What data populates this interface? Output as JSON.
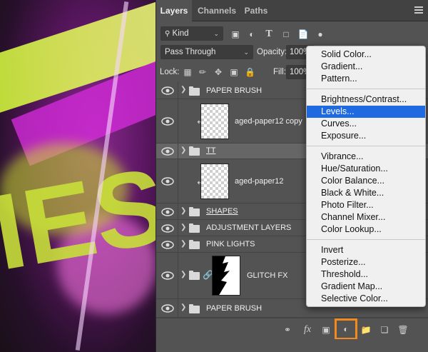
{
  "colors": {
    "accent_orange": "#f28a1e",
    "menu_highlight": "#1f6ae0",
    "panel_bg": "#535353",
    "selected_row": "#666666"
  },
  "tabs": [
    "Layers",
    "Channels",
    "Paths"
  ],
  "filter": {
    "kind_label": "Kind"
  },
  "blend": {
    "mode": "Pass Through",
    "opacity_label": "Opacity:",
    "opacity_value": "100%"
  },
  "lock": {
    "label": "Lock:",
    "fill_label": "Fill:",
    "fill_value": "100%"
  },
  "layers": [
    {
      "name": "PAPER BRUSH",
      "type": "group"
    },
    {
      "name": "aged-paper12 copy",
      "type": "pixel-clipped"
    },
    {
      "name": "TT",
      "type": "group",
      "selected": true
    },
    {
      "name": "aged-paper12",
      "type": "pixel-clipped"
    },
    {
      "name": "SHAPES",
      "type": "group"
    },
    {
      "name": "ADJUSTMENT LAYERS",
      "type": "group"
    },
    {
      "name": "PINK LIGHTS",
      "type": "group"
    },
    {
      "name": "GLITCH FX",
      "type": "group-masked"
    },
    {
      "name": "PAPER BRUSH",
      "type": "group"
    }
  ],
  "menu": {
    "sections": [
      [
        "Solid Color...",
        "Gradient...",
        "Pattern..."
      ],
      [
        "Brightness/Contrast...",
        "Levels...",
        "Curves...",
        "Exposure..."
      ],
      [
        "Vibrance...",
        "Hue/Saturation...",
        "Color Balance...",
        "Black & White...",
        "Photo Filter...",
        "Channel Mixer...",
        "Color Lookup..."
      ],
      [
        "Invert",
        "Posterize...",
        "Threshold...",
        "Gradient Map...",
        "Selective Color..."
      ]
    ],
    "highlighted": "Levels..."
  },
  "bottom_icons": [
    "link-icon",
    "fx-icon",
    "mask-icon",
    "adjustment-icon",
    "new-group-icon",
    "new-layer-icon",
    "trash-icon"
  ]
}
